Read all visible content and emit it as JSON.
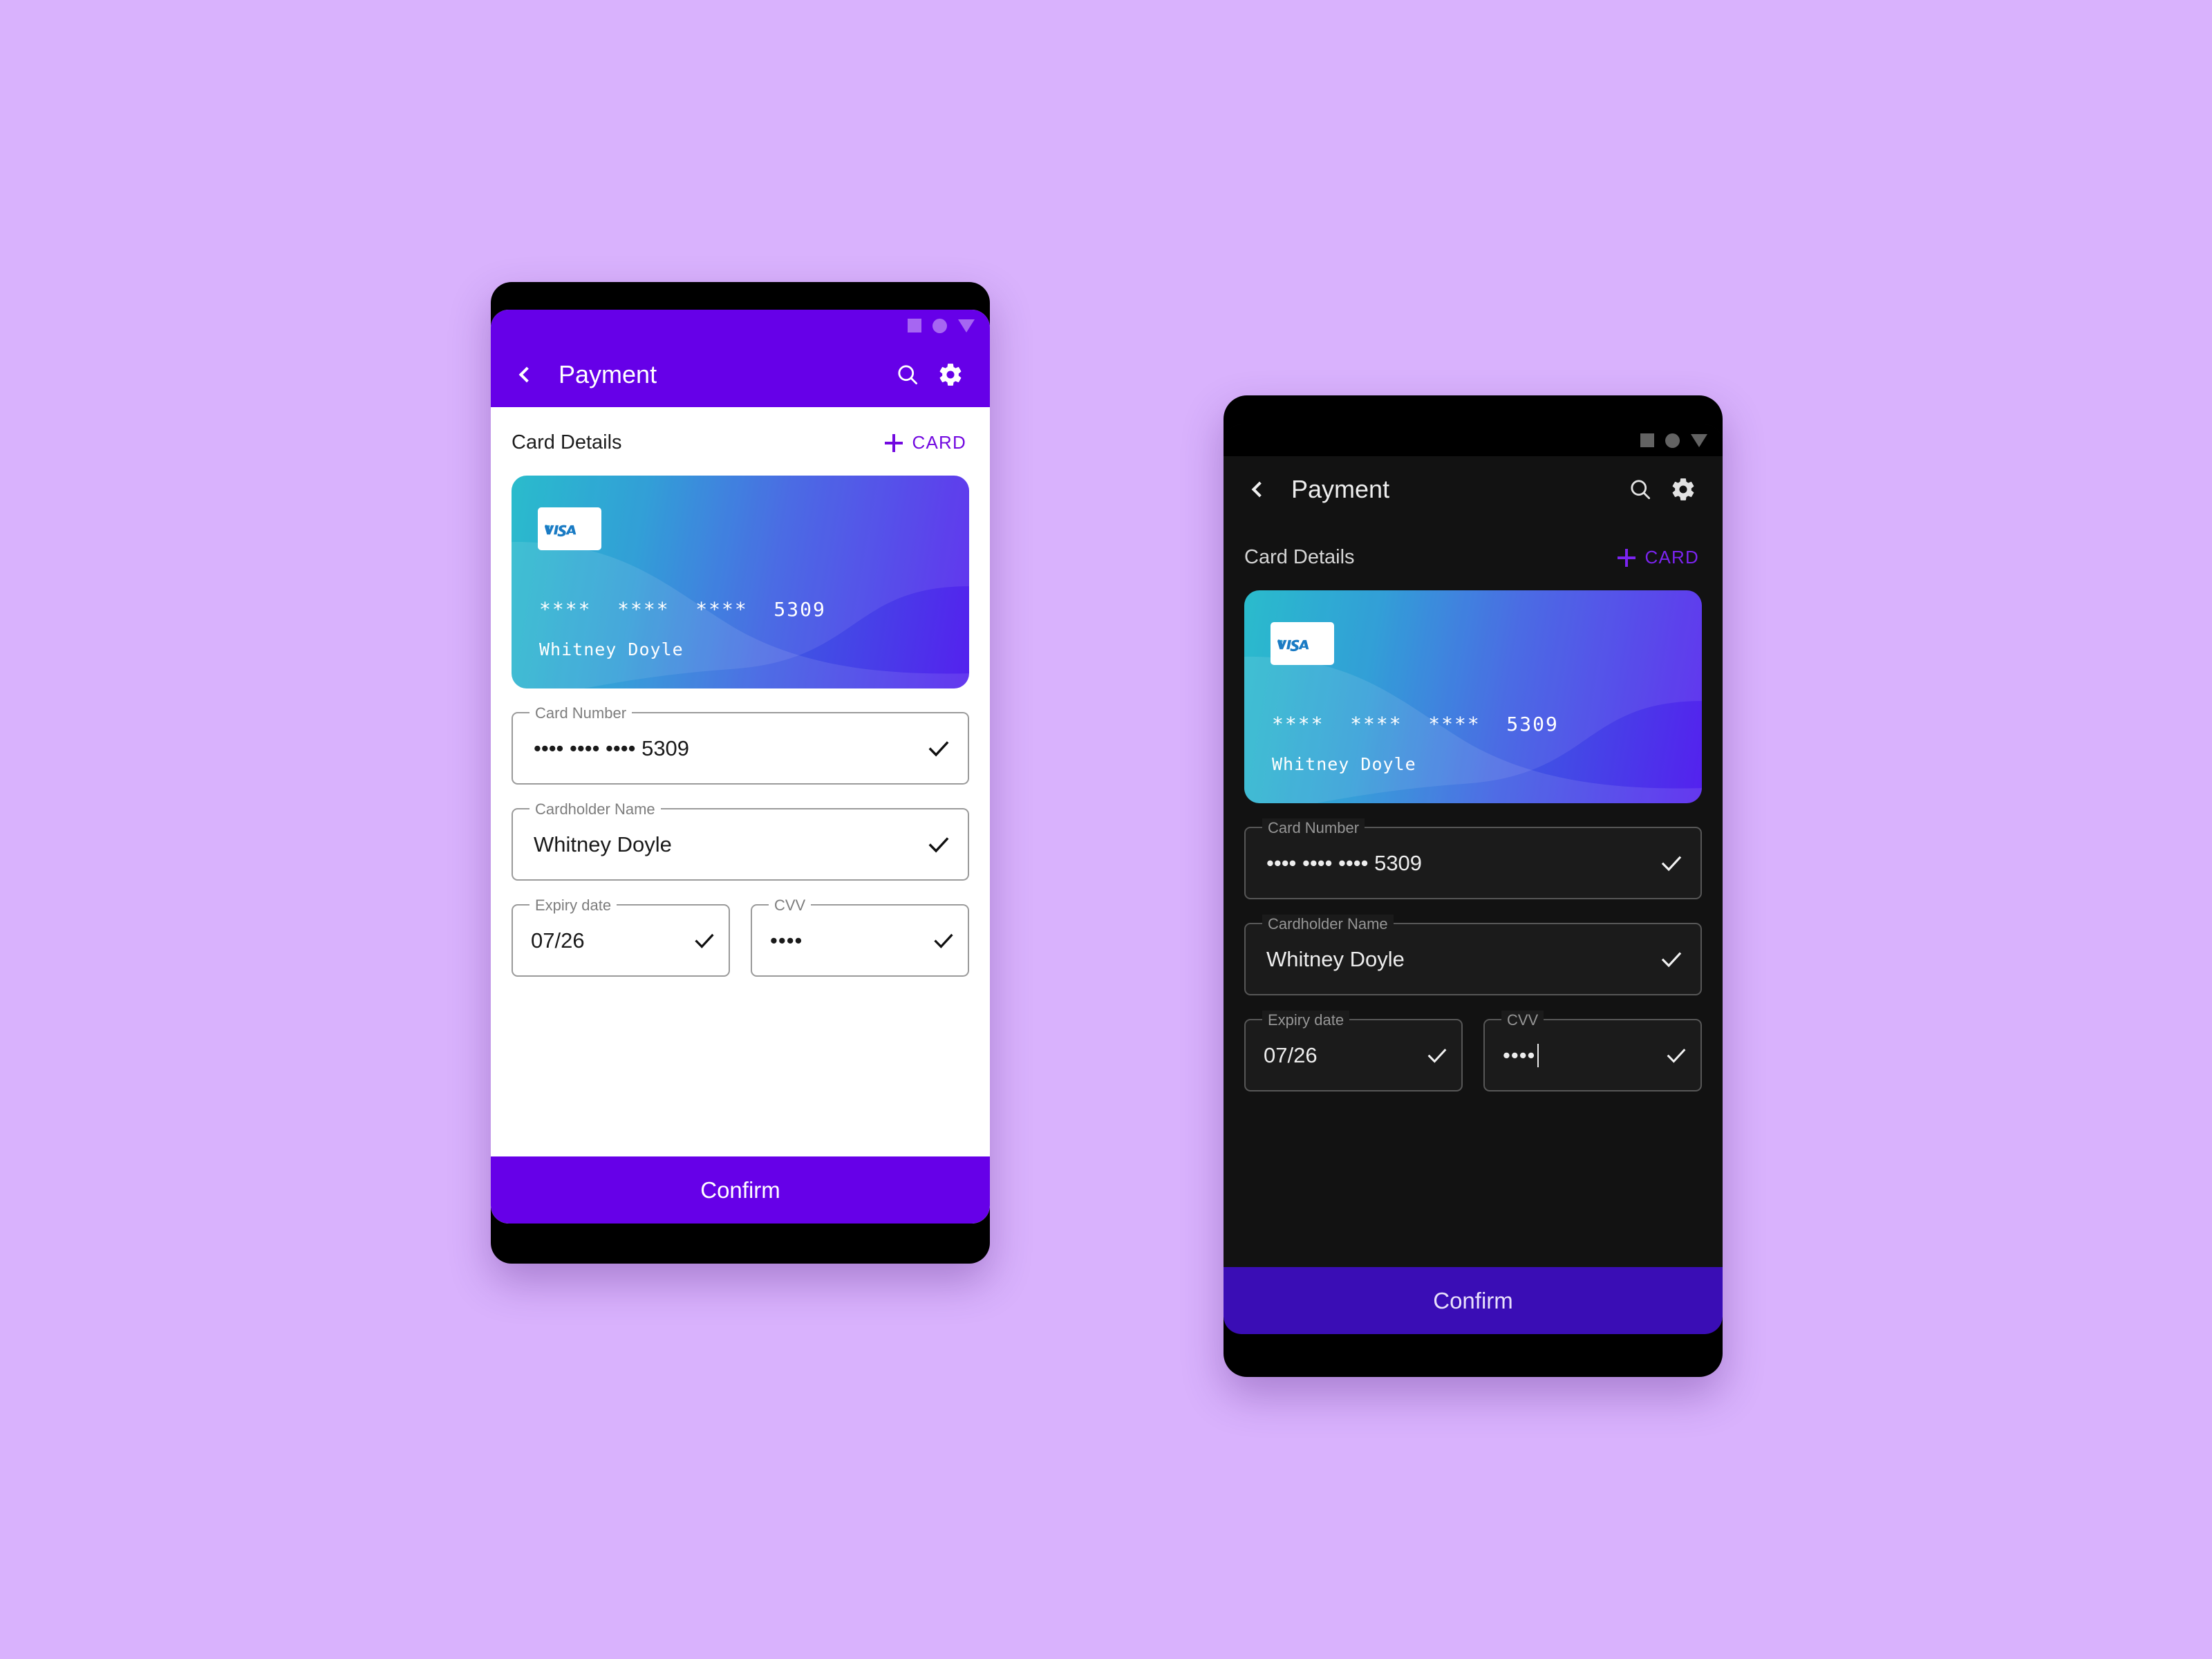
{
  "page": {
    "background_color": "#d9b2fd",
    "variants": [
      "light",
      "dark"
    ]
  },
  "colors": {
    "accent_purple": "#6600e8",
    "accent_purple_text": "#7209e0",
    "accent_purple_dark": "#7b24f0",
    "confirm_dark": "#3a0db5",
    "card_gradient_start": "#16b6c8",
    "card_gradient_end": "#5421ee",
    "visa_blue": "#1a7bc4",
    "light_surface": "#ffffff",
    "dark_surface": "#121212",
    "dark_field_surface": "#1b1b1b"
  },
  "light": {
    "statusbar": {
      "icons": [
        "square-icon",
        "circle-icon",
        "triangle-down-icon"
      ]
    },
    "appbar": {
      "back_icon": "chevron-left-icon",
      "title": "Payment",
      "search_icon": "search-icon",
      "settings_icon": "gear-icon"
    },
    "section": {
      "title": "Card Details",
      "add_icon": "plus-icon",
      "add_label": "CARD"
    },
    "card": {
      "brand": "VISA",
      "number_masked": "****  ****  ****  5309",
      "holder_name": "Whitney Doyle"
    },
    "fields": [
      {
        "name": "card-number",
        "label": "Card Number",
        "value": "•••• •••• •••• 5309",
        "valid_icon": "check-icon",
        "has_caret": false
      },
      {
        "name": "cardholder-name",
        "label": "Cardholder Name",
        "value": "Whitney Doyle",
        "valid_icon": "check-icon",
        "has_caret": false
      },
      {
        "name": "expiry-date",
        "label": "Expiry date",
        "value": "07/26",
        "valid_icon": "check-icon",
        "has_caret": false
      },
      {
        "name": "cvv",
        "label": "CVV",
        "value": "••••",
        "valid_icon": "check-icon",
        "has_caret": false
      }
    ],
    "confirm_label": "Confirm"
  },
  "dark": {
    "statusbar": {
      "icons": [
        "square-icon",
        "circle-icon",
        "triangle-down-icon"
      ]
    },
    "appbar": {
      "back_icon": "chevron-left-icon",
      "title": "Payment",
      "search_icon": "search-icon",
      "settings_icon": "gear-icon"
    },
    "section": {
      "title": "Card Details",
      "add_icon": "plus-icon",
      "add_label": "CARD"
    },
    "card": {
      "brand": "VISA",
      "number_masked": "****  ****  ****  5309",
      "holder_name": "Whitney Doyle"
    },
    "fields": [
      {
        "name": "card-number",
        "label": "Card Number",
        "value": "•••• •••• •••• 5309",
        "valid_icon": "check-icon",
        "has_caret": false
      },
      {
        "name": "cardholder-name",
        "label": "Cardholder Name",
        "value": "Whitney Doyle",
        "valid_icon": "check-icon",
        "has_caret": false
      },
      {
        "name": "expiry-date",
        "label": "Expiry date",
        "value": "07/26",
        "valid_icon": "check-icon",
        "has_caret": false
      },
      {
        "name": "cvv",
        "label": "CVV",
        "value": "••••",
        "valid_icon": "check-icon",
        "has_caret": true
      }
    ],
    "confirm_label": "Confirm"
  }
}
